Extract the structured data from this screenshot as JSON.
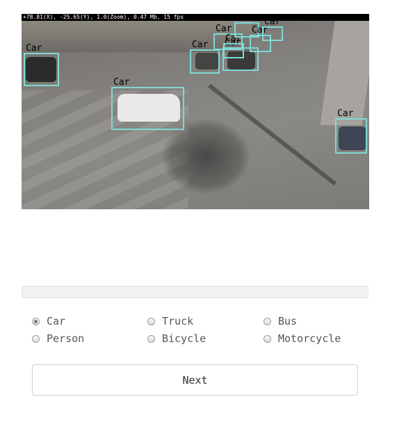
{
  "viewer": {
    "status_text": "+78.81(X), -25.65(Y), 1.0(Zoom), 0.47 Mb, 15 fps",
    "box_color": "#7fd9d6",
    "detections": [
      {
        "label": "Car"
      },
      {
        "label": "Car"
      },
      {
        "label": "Car"
      },
      {
        "label": "Car"
      },
      {
        "label": "Car"
      },
      {
        "label": "Car"
      },
      {
        "label": "Car"
      },
      {
        "label": "Car"
      },
      {
        "label": "Car"
      },
      {
        "label": "Car"
      }
    ]
  },
  "progress": {
    "value": 0
  },
  "options": {
    "selected": "Car",
    "items": [
      {
        "label": "Car",
        "checked": true
      },
      {
        "label": "Truck",
        "checked": false
      },
      {
        "label": "Bus",
        "checked": false
      },
      {
        "label": "Person",
        "checked": false
      },
      {
        "label": "Bicycle",
        "checked": false
      },
      {
        "label": "Motorcycle",
        "checked": false
      }
    ]
  },
  "buttons": {
    "next_label": "Next"
  }
}
